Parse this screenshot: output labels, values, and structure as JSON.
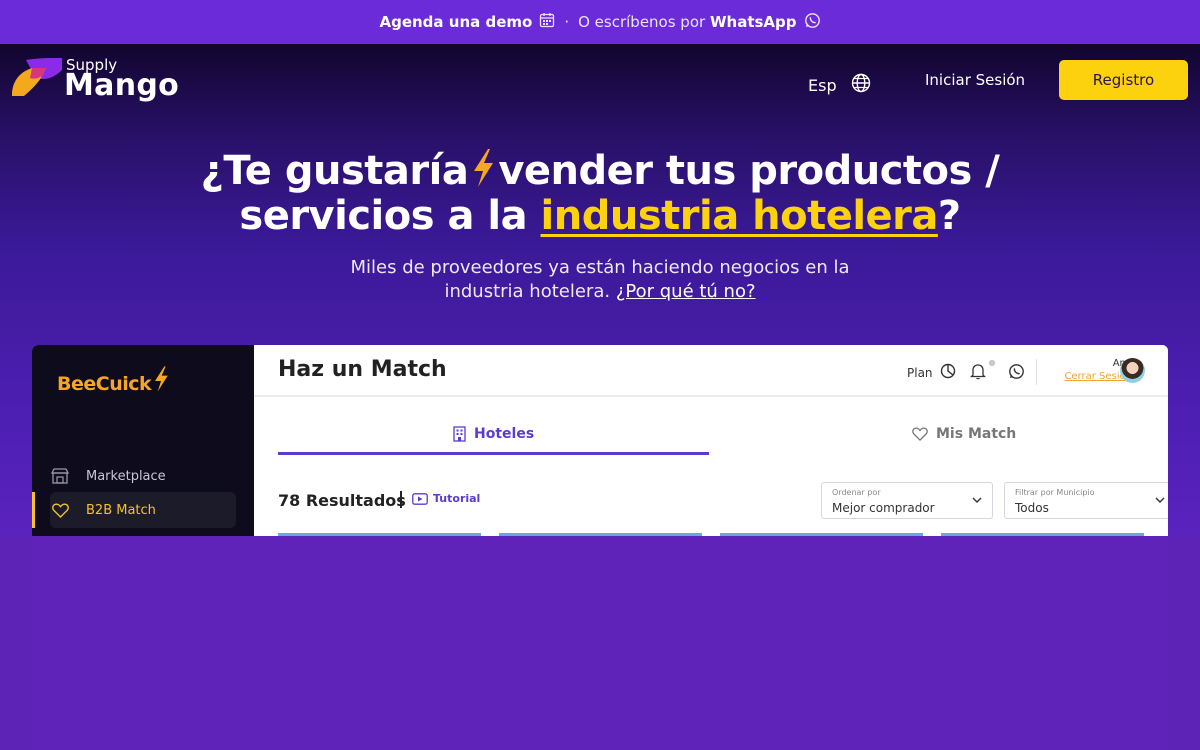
{
  "topbar": {
    "demo_label": "Agenda una demo",
    "separator": "·",
    "contact_text": "O escríbenos por",
    "whatsapp_label": "WhatsApp"
  },
  "nav": {
    "logo_small": "Supply",
    "logo_big": "Mango",
    "language": "Esp",
    "login_label": "Iniciar Sesión",
    "register_label": "Registro"
  },
  "hero": {
    "headline_part1": "¿Te gustaría",
    "headline_part2": "vender tus productos /",
    "headline_part3": "servicios a la",
    "headline_highlight": "industria hotelera",
    "headline_end": "?",
    "subtitle": "Miles de proveedores ya están haciendo negocios en la industria hotelera.",
    "subtitle_link": "¿Por qué tú no?"
  },
  "preview": {
    "brand": "BeeCuick",
    "sidebar": [
      {
        "label": "Marketplace",
        "icon": "store-icon",
        "active": false
      },
      {
        "label": "B2B Match",
        "icon": "heart-icon",
        "active": true
      }
    ],
    "title": "Haz un Match",
    "plan_label": "Plan",
    "user_name": "Ana",
    "logout_label": "Cerrar Sesión",
    "tabs": [
      {
        "label": "Hoteles",
        "icon": "building-icon",
        "active": true
      },
      {
        "label": "Mis Match",
        "icon": "heart-icon",
        "active": false
      }
    ],
    "results_label": "78 Resultados",
    "tutorial_label": "Tutorial",
    "order_select": {
      "label": "Ordenar por",
      "value": "Mejor comprador"
    },
    "filter_select": {
      "label": "Filtrar por Municipio",
      "value": "Todos"
    }
  },
  "colors": {
    "primary_purple": "#6c2bd9",
    "accent_yellow": "#fcd20f",
    "brand_orange": "#f6a623"
  }
}
